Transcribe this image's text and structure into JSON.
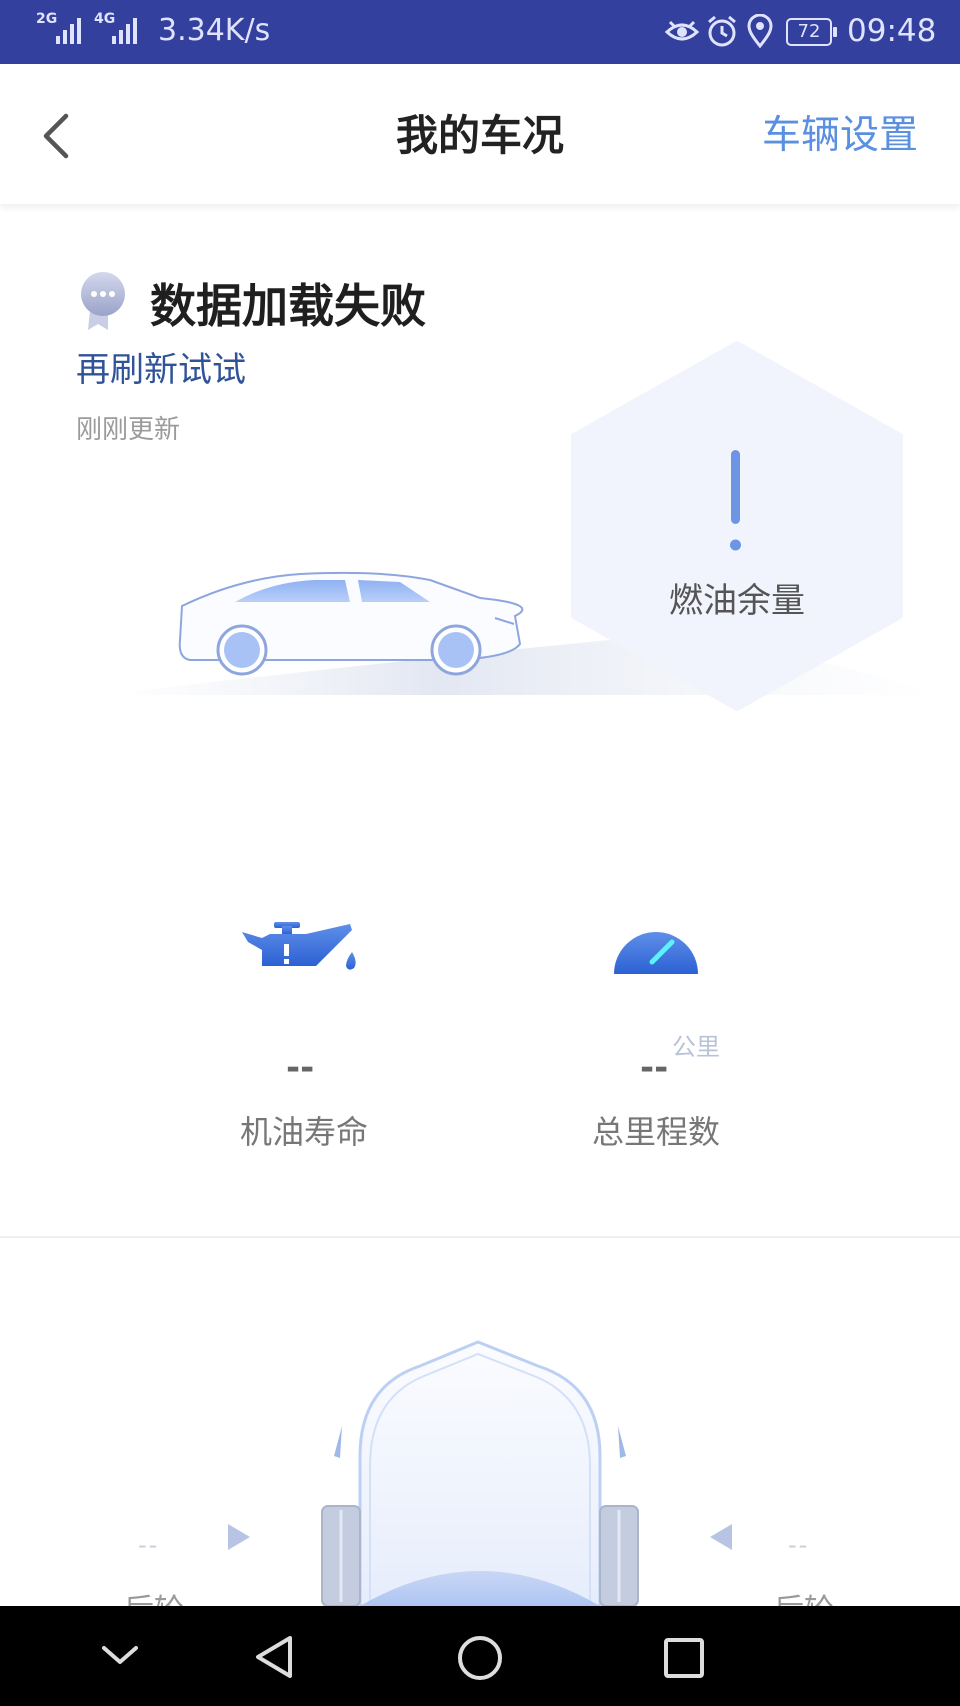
{
  "status_bar": {
    "signal_1": "2G",
    "signal_2": "4G",
    "net_speed": "3.34K/s",
    "battery": "72",
    "time": "09:48",
    "icons": [
      "eye-icon",
      "alarm-icon",
      "location-icon",
      "battery-icon"
    ]
  },
  "header": {
    "title": "我的车况",
    "settings_label": "车辆设置"
  },
  "status": {
    "error_title": "数据加载失败",
    "refresh_label": "再刷新试试",
    "updated_text": "刚刚更新"
  },
  "fuel": {
    "label": "燃油余量"
  },
  "metrics": {
    "oil": {
      "value": "--",
      "label": "机油寿命"
    },
    "mileage": {
      "value": "--",
      "unit": "公里",
      "label": "总里程数"
    }
  },
  "tires": {
    "left": {
      "value": "--",
      "label": "后轮"
    },
    "right": {
      "value": "--",
      "label": "后轮"
    }
  },
  "colors": {
    "status_bar": "#33409e",
    "accent": "#5b8fe0",
    "link": "#2f5298"
  }
}
